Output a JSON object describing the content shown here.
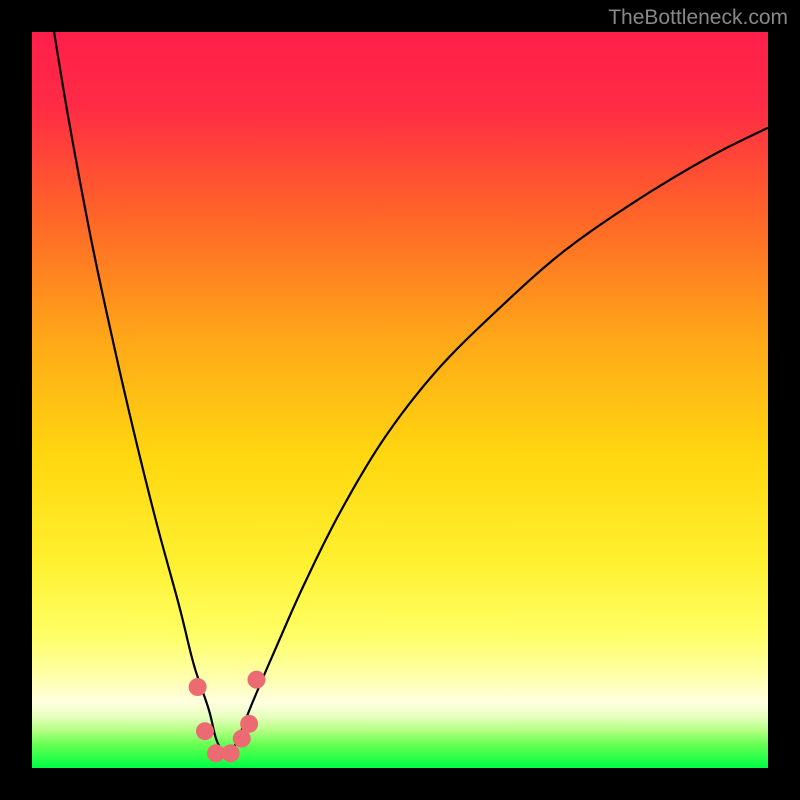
{
  "watermark": "TheBottleneck.com",
  "chart_data": {
    "type": "line",
    "title": "",
    "xlabel": "",
    "ylabel": "",
    "xlim": [
      0,
      100
    ],
    "ylim": [
      0,
      100
    ],
    "gradient_colors": {
      "top": "#ff1f4a",
      "upper_mid": "#ff7a1f",
      "mid": "#ffd500",
      "lower_mid": "#ffff66",
      "pale_yellow": "#ffffcc",
      "green_start": "#b0ff80",
      "bottom": "#00ff44"
    },
    "curve": {
      "description": "V-shaped bottleneck curve with minimum around x=26",
      "left_branch_x": [
        3,
        5,
        8,
        11,
        14,
        17,
        20,
        22,
        24,
        25,
        26
      ],
      "left_branch_y": [
        100,
        88,
        72,
        58,
        45,
        33,
        22,
        14,
        8,
        4,
        2
      ],
      "right_branch_x": [
        27,
        28,
        30,
        33,
        37,
        42,
        48,
        55,
        63,
        72,
        82,
        92,
        100
      ],
      "right_branch_y": [
        2,
        4,
        9,
        16,
        25,
        35,
        45,
        54,
        62,
        70,
        77,
        83,
        87
      ]
    },
    "markers": {
      "color": "#ec6b72",
      "points": [
        {
          "x": 22.5,
          "y": 11
        },
        {
          "x": 23.5,
          "y": 5
        },
        {
          "x": 25,
          "y": 2
        },
        {
          "x": 27,
          "y": 2
        },
        {
          "x": 28.5,
          "y": 4
        },
        {
          "x": 29.5,
          "y": 6
        },
        {
          "x": 30.5,
          "y": 12
        }
      ]
    }
  }
}
